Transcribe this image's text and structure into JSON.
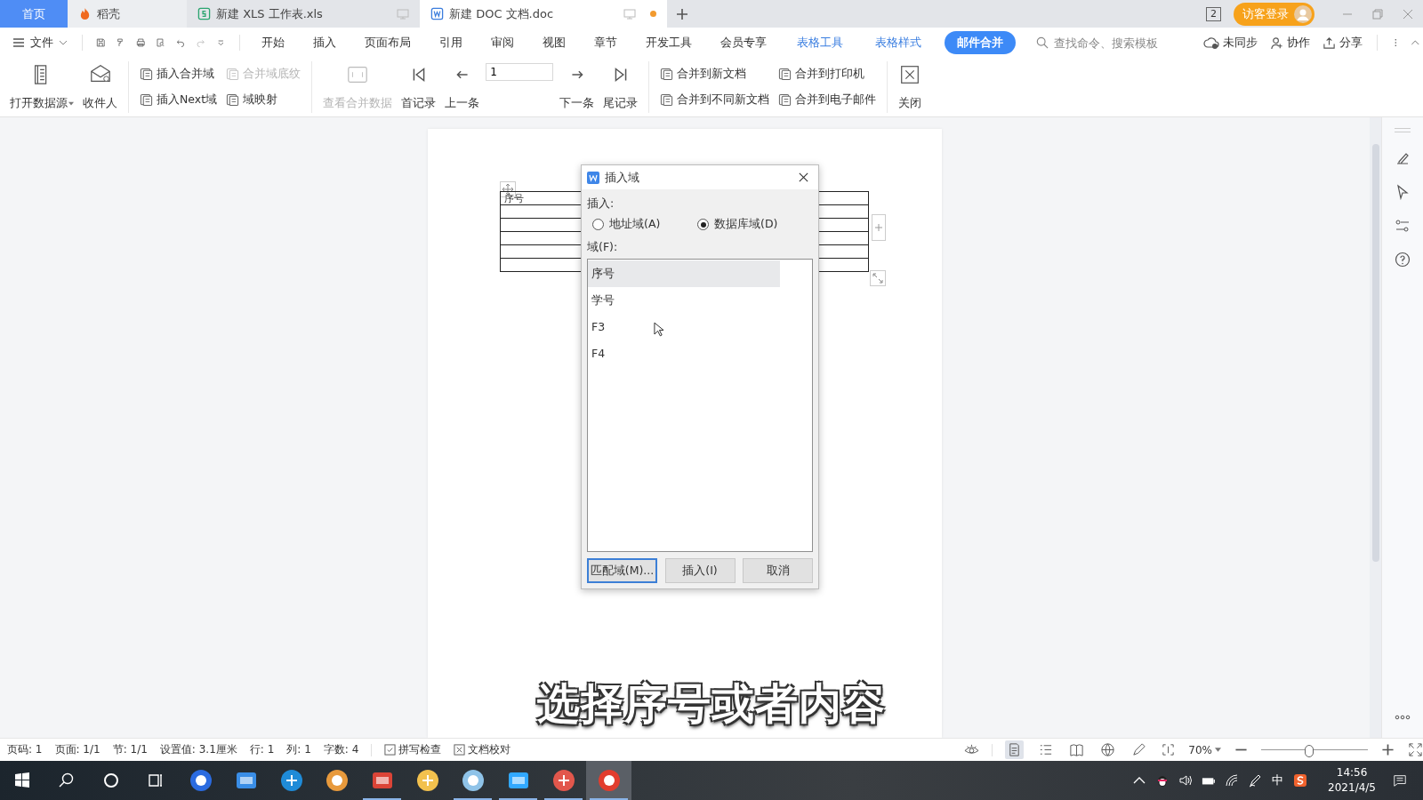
{
  "tabs": [
    {
      "label": "首页",
      "kind": "home",
      "selected": false
    },
    {
      "label": "稻壳",
      "kind": "docer",
      "selected": false
    },
    {
      "label": "新建 XLS 工作表.xls",
      "kind": "sheet",
      "selected": false,
      "unsaved": false
    },
    {
      "label": "新建 DOC 文档.doc",
      "kind": "doc",
      "selected": true,
      "unsaved": true
    }
  ],
  "account": {
    "window_count": "2",
    "login": "访客登录"
  },
  "menu": {
    "file": "文件",
    "items": [
      {
        "label": "开始",
        "kind": "plain",
        "selected": false
      },
      {
        "label": "插入",
        "kind": "plain",
        "selected": false
      },
      {
        "label": "页面布局",
        "kind": "plain",
        "selected": false
      },
      {
        "label": "引用",
        "kind": "plain",
        "selected": false
      },
      {
        "label": "审阅",
        "kind": "plain",
        "selected": false
      },
      {
        "label": "视图",
        "kind": "plain",
        "selected": false
      },
      {
        "label": "章节",
        "kind": "plain",
        "selected": false
      },
      {
        "label": "开发工具",
        "kind": "plain",
        "selected": false
      },
      {
        "label": "会员专享",
        "kind": "plain",
        "selected": false
      },
      {
        "label": "表格工具",
        "kind": "context",
        "selected": false
      },
      {
        "label": "表格样式",
        "kind": "context",
        "selected": false
      },
      {
        "label": "邮件合并",
        "kind": "context",
        "selected": true
      }
    ],
    "search": {
      "placeholder": "查找命令、搜索模板"
    },
    "actions": [
      "未同步",
      "协作",
      "分享"
    ]
  },
  "ribbon": [
    {
      "kind": "large",
      "label": "打开数据源",
      "disabled": false,
      "dropdown": true
    },
    {
      "kind": "large",
      "label": "收件人",
      "disabled": false,
      "dropdown": false
    },
    {
      "kind": "divider"
    },
    {
      "kind": "stack",
      "items": [
        {
          "label": "插入合并域",
          "disabled": false
        },
        {
          "label": "插入Next域",
          "disabled": false
        }
      ]
    },
    {
      "kind": "stack",
      "items": [
        {
          "label": "合并域底纹",
          "disabled": true
        },
        {
          "label": "域映射",
          "disabled": false
        }
      ]
    },
    {
      "kind": "divider"
    },
    {
      "kind": "large",
      "label": "查看合并数据",
      "disabled": true,
      "dropdown": false
    },
    {
      "kind": "large",
      "label": "首记录",
      "disabled": false,
      "dropdown": false
    },
    {
      "kind": "large",
      "label": "上一条",
      "disabled": false,
      "dropdown": false
    },
    {
      "kind": "record",
      "value": "1"
    },
    {
      "kind": "large",
      "label": "下一条",
      "disabled": false,
      "dropdown": false
    },
    {
      "kind": "large",
      "label": "尾记录",
      "disabled": false,
      "dropdown": false
    },
    {
      "kind": "divider"
    },
    {
      "kind": "stack",
      "items": [
        {
          "label": "合并到新文档",
          "disabled": false
        },
        {
          "label": "合并到不同新文档",
          "disabled": false
        }
      ]
    },
    {
      "kind": "stack",
      "items": [
        {
          "label": "合并到打印机",
          "disabled": false
        },
        {
          "label": "合并到电子邮件",
          "disabled": false
        }
      ]
    },
    {
      "kind": "divider"
    },
    {
      "kind": "large",
      "label": "关闭",
      "disabled": false,
      "dropdown": false
    }
  ],
  "table": {
    "heading": "序号"
  },
  "dialog": {
    "title": "插入域",
    "insert_label": "插入:",
    "options": [
      {
        "label": "地址域(A)",
        "selected": false
      },
      {
        "label": "数据库域(D)",
        "selected": true
      }
    ],
    "fields_label": "域(F):",
    "fields": [
      {
        "label": "序号",
        "selected": true
      },
      {
        "label": "学号",
        "selected": false
      },
      {
        "label": "F3",
        "selected": false
      },
      {
        "label": "F4",
        "selected": false
      }
    ],
    "buttons": [
      {
        "label": "匹配域(M)...",
        "default": true
      },
      {
        "label": "插入(I)",
        "default": false
      },
      {
        "label": "取消",
        "default": false
      }
    ]
  },
  "caption": "选择序号或者内容",
  "status_bar": {
    "items": [
      "页码: 1",
      "页面: 1/1",
      "节: 1/1",
      "设置值: 3.1厘米",
      "行: 1",
      "列: 1",
      "字数: 4"
    ],
    "tools": [
      "拼写检查",
      "文档校对"
    ],
    "view_modes": [
      {
        "selected": true
      },
      {
        "selected": false
      },
      {
        "selected": false
      },
      {
        "selected": false
      },
      {
        "selected": false
      }
    ],
    "zoom": "70%",
    "zoom_slider": {
      "level": 0.45
    }
  },
  "taskbar": {
    "apps": [
      {
        "running": false,
        "active": false
      },
      {
        "running": false,
        "active": false
      },
      {
        "running": false,
        "active": false
      },
      {
        "running": false,
        "active": false
      },
      {
        "running": true,
        "active": false
      },
      {
        "running": false,
        "active": false
      },
      {
        "running": true,
        "active": false
      },
      {
        "running": true,
        "active": false
      },
      {
        "running": true,
        "active": false
      },
      {
        "running": true,
        "active": true
      }
    ],
    "ime": "中",
    "time": "14:56",
    "date": "2021/4/5"
  }
}
